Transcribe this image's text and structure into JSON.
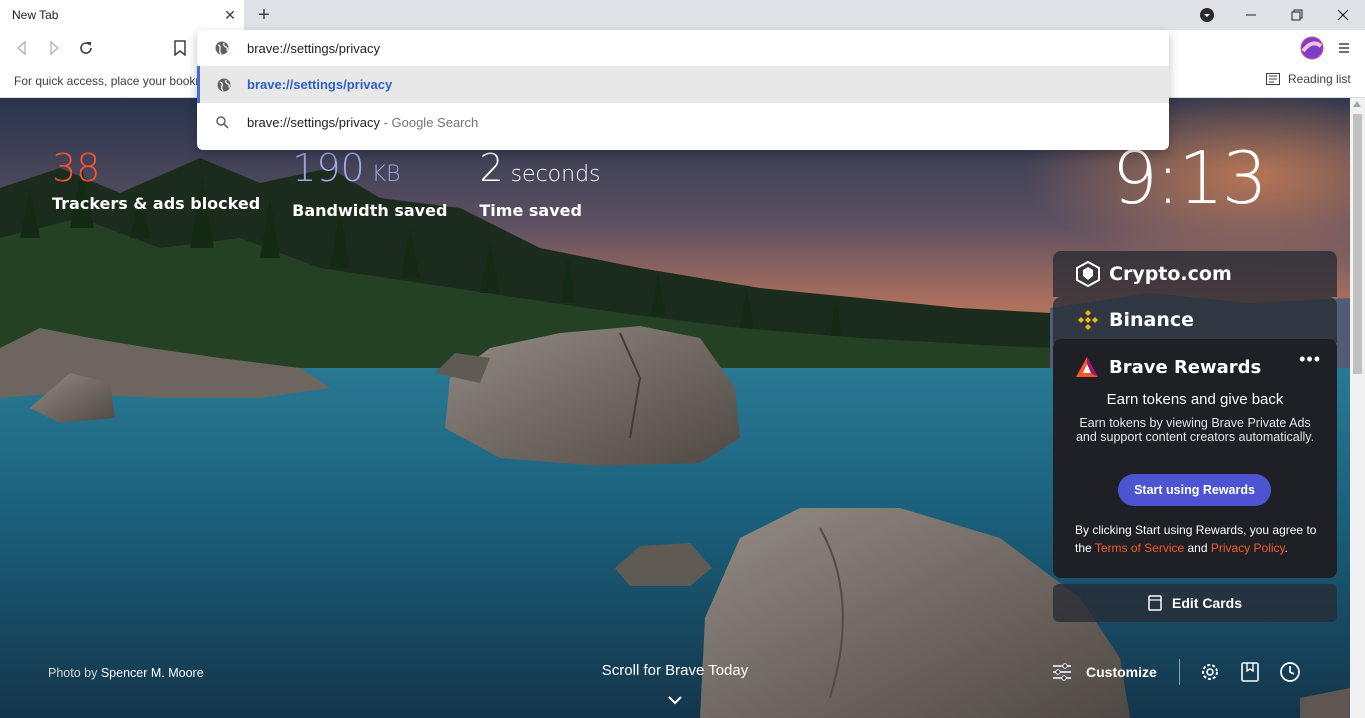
{
  "tabstrip": {
    "tab_title": "New Tab",
    "new_tab_symbol": "+"
  },
  "omnibox": {
    "input_value": "brave://settings/privacy",
    "suggestions": [
      {
        "text": "brave://settings/privacy",
        "suffix": "",
        "icon": "globe-icon"
      },
      {
        "text": "brave://settings/privacy",
        "suffix": " - Google Search",
        "icon": "search-icon"
      }
    ]
  },
  "bookmarks_bar": {
    "hint": "For quick access, place your bookmarks here",
    "reading_list": "Reading list"
  },
  "stats": [
    {
      "value": "38",
      "unit": "",
      "label": "Trackers & ads blocked",
      "color": "#fb542b"
    },
    {
      "value": "190",
      "unit": " KB",
      "label": "Bandwidth saved",
      "color": "#a0a5eb"
    },
    {
      "value": "2",
      "unit": " seconds",
      "label": "Time saved",
      "color": "#ffffff"
    }
  ],
  "clock": "9:13",
  "cards": {
    "crypto": "Crypto.com",
    "binance": "Binance",
    "rewards": {
      "header": "Brave Rewards",
      "title": "Earn tokens and give back",
      "description": "Earn tokens by viewing Brave Private Ads and support content creators automatically.",
      "button": "Start using Rewards",
      "legal_prefix": "By clicking Start using Rewards, you agree to the ",
      "terms": "Terms of Service",
      "legal_and": " and ",
      "privacy": "Privacy Policy",
      "legal_suffix": "."
    },
    "edit_cards": "Edit Cards"
  },
  "footer": {
    "photo_prefix": "Photo by ",
    "photographer": "Spencer M. Moore",
    "scroll_label": "Scroll for Brave Today",
    "customize": "Customize"
  },
  "colors": {
    "accent": "#4c54d2",
    "brave_orange": "#fb542b",
    "selected_bar": "#3f6fd6"
  }
}
